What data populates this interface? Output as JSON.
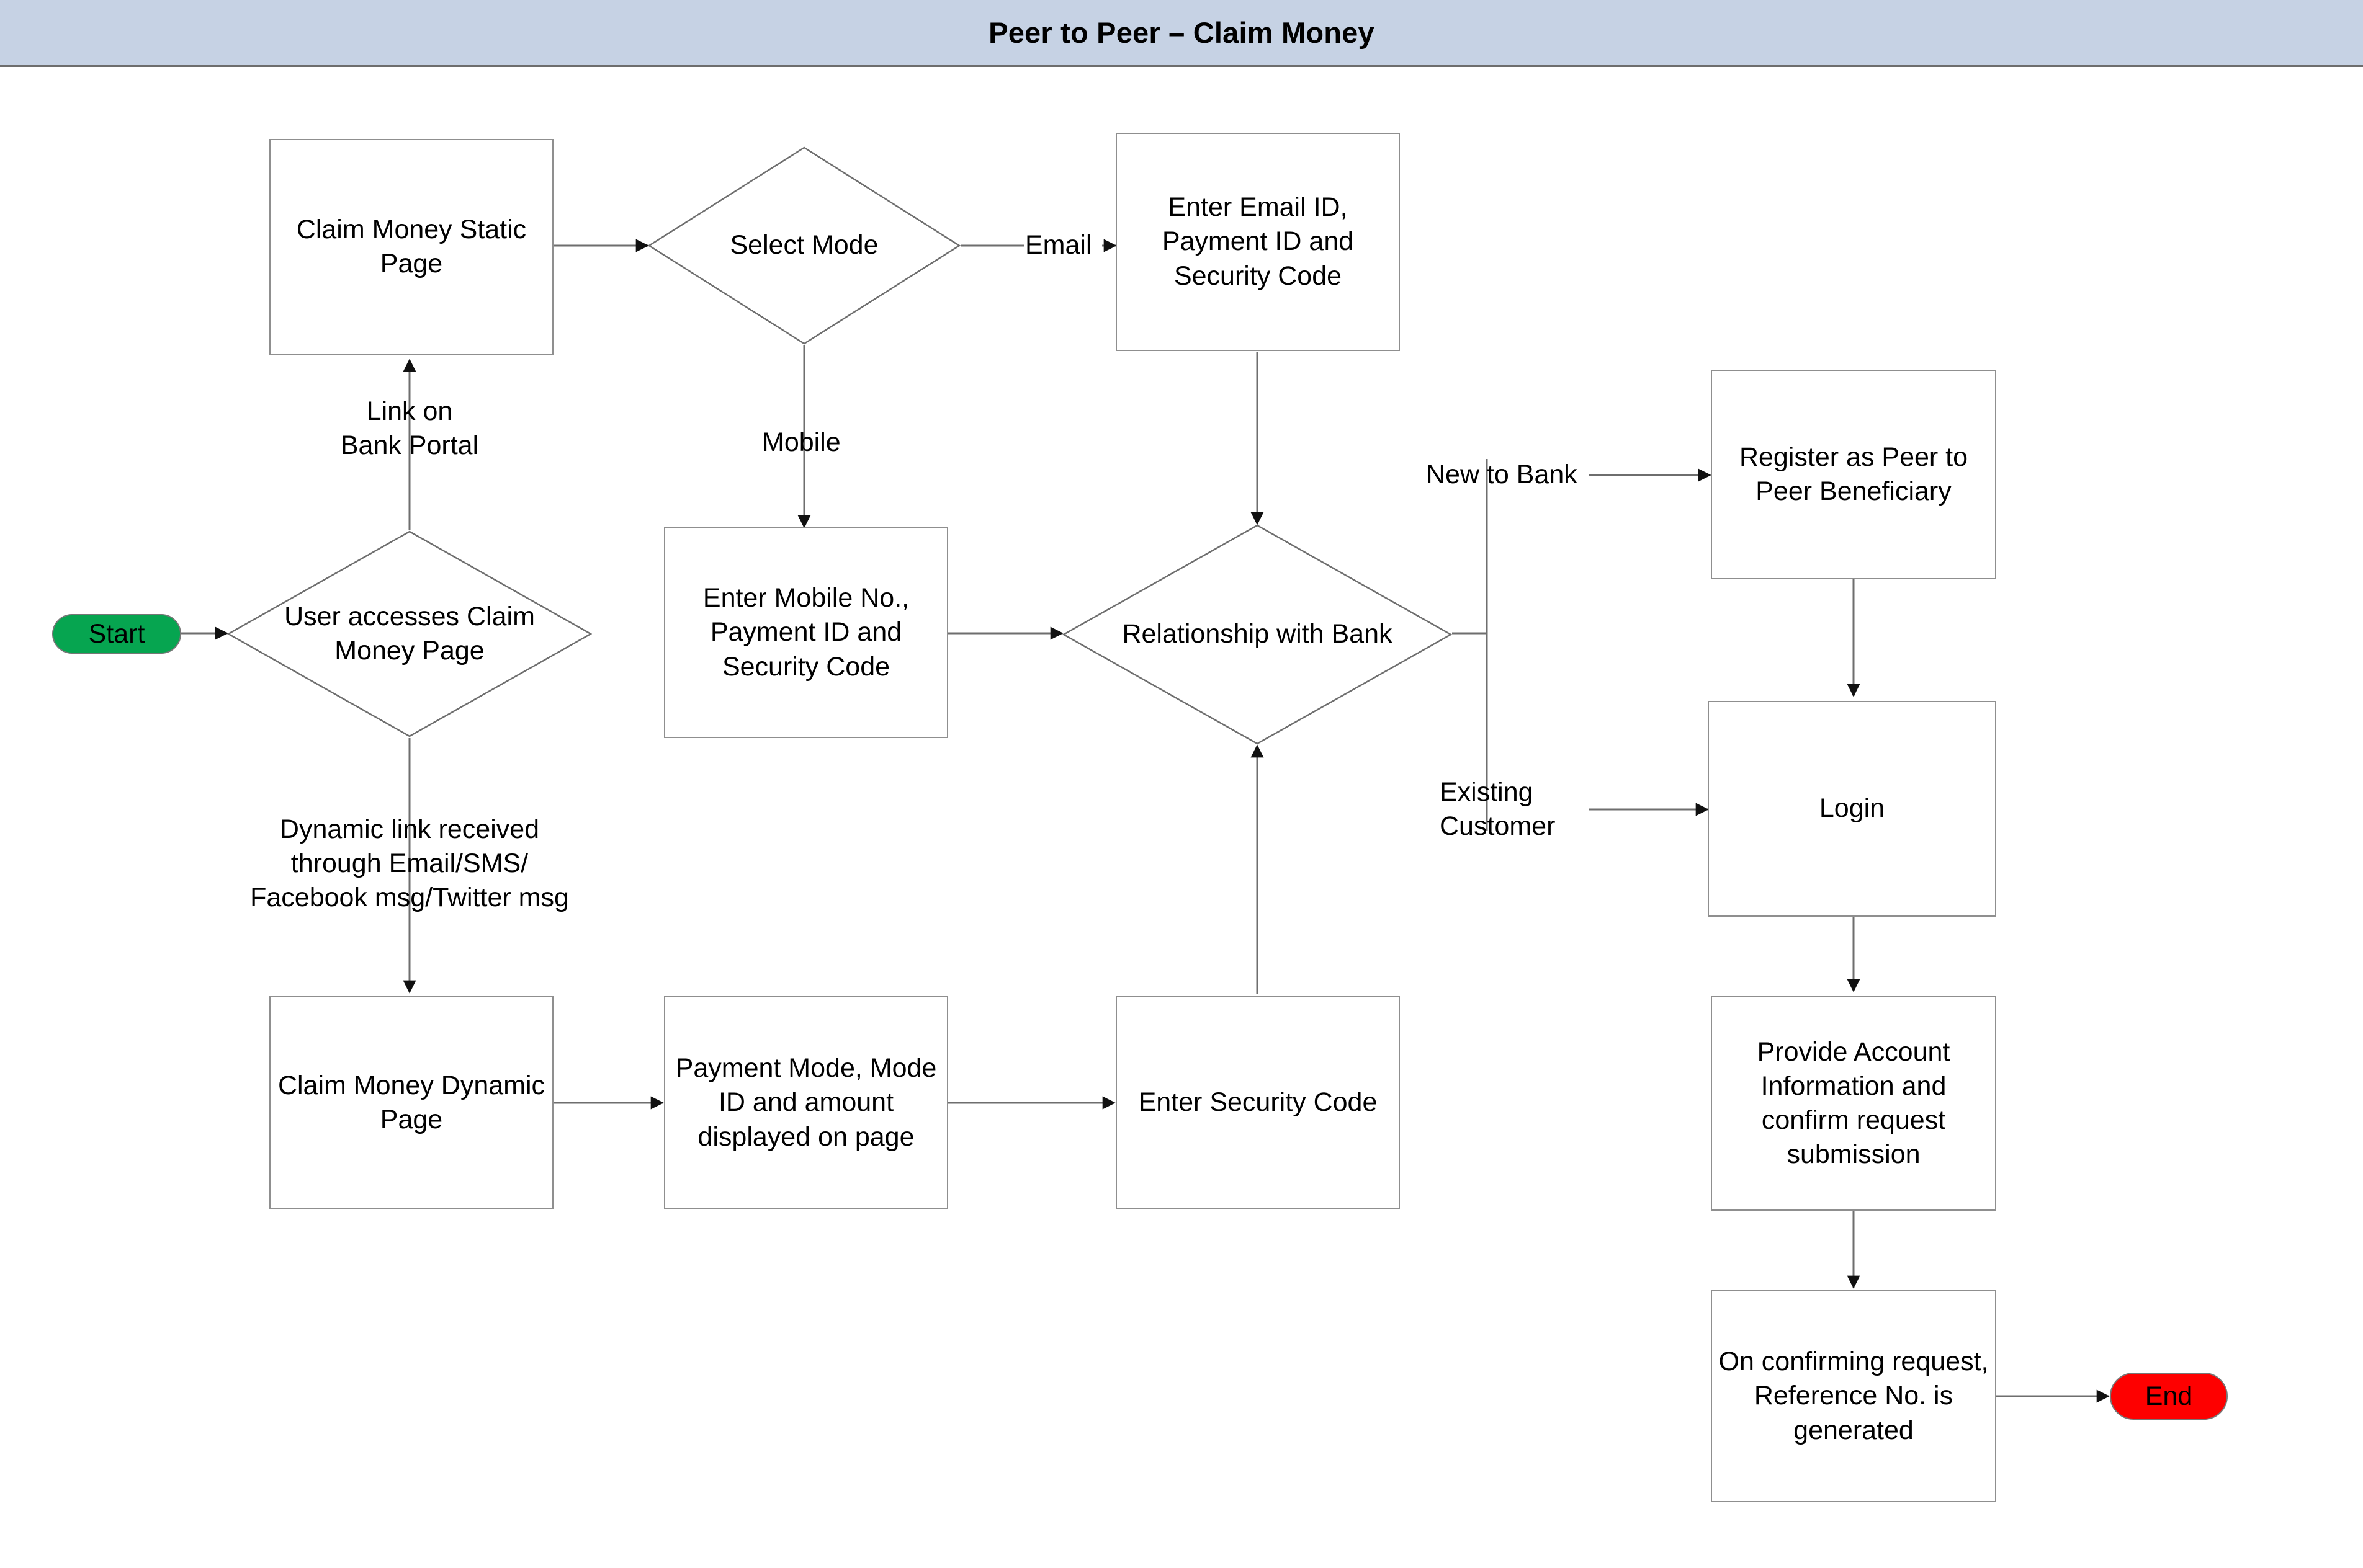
{
  "header": {
    "title": "Peer to Peer – Claim Money",
    "background_color": "#C6D2E4"
  },
  "colors": {
    "start_fill": "#06A550",
    "end_fill": "#FE0000",
    "node_border": "#8F8F8F",
    "edge_stroke": "#6E6E6E",
    "text": "#000000",
    "page_background": "#FFFFFF"
  },
  "flow": {
    "nodes": {
      "start": {
        "label": "Start",
        "shape": "terminator"
      },
      "user_accesses": {
        "label": "User accesses Claim Money Page",
        "shape": "decision"
      },
      "static_page": {
        "label": "Claim Money Static Page",
        "shape": "process"
      },
      "select_mode": {
        "label": "Select Mode",
        "shape": "decision"
      },
      "enter_email": {
        "label": "Enter Email ID, Payment ID and Security Code",
        "shape": "process"
      },
      "enter_mobile": {
        "label": "Enter Mobile No., Payment ID and Security Code",
        "shape": "process"
      },
      "relationship": {
        "label": "Relationship with Bank",
        "shape": "decision"
      },
      "register_peer": {
        "label": "Register as Peer to Peer Beneficiary",
        "shape": "process"
      },
      "login": {
        "label": "Login",
        "shape": "process"
      },
      "provide_account": {
        "label": "Provide Account Information and confirm request submission",
        "shape": "process"
      },
      "reference_no": {
        "label": "On confirming request, Reference No. is generated",
        "shape": "process"
      },
      "dynamic_page": {
        "label": "Claim Money Dynamic Page",
        "shape": "process"
      },
      "payment_mode": {
        "label": "Payment Mode, Mode ID and amount displayed on page",
        "shape": "process"
      },
      "enter_security": {
        "label": "Enter Security Code",
        "shape": "process"
      },
      "end": {
        "label": "End",
        "shape": "terminator"
      }
    },
    "edge_labels": {
      "link_bank_portal": "Link on\nBank Portal",
      "dynamic_link": "Dynamic link received\nthrough Email/SMS/\nFacebook msg/Twitter msg",
      "email": "Email",
      "mobile": "Mobile",
      "new_to_bank": "New to Bank",
      "existing_customer": "Existing\nCustomer"
    }
  }
}
